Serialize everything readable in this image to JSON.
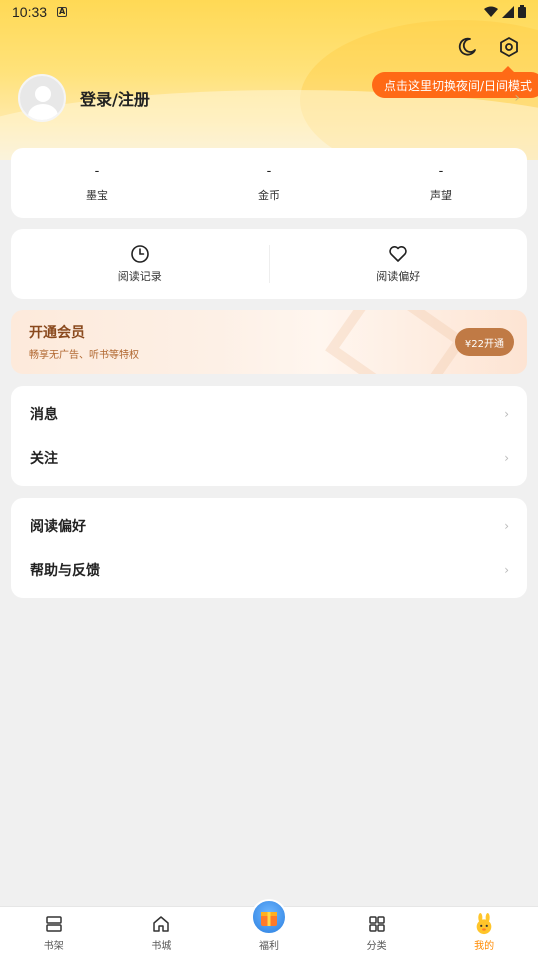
{
  "status_bar": {
    "time": "10:33",
    "a_label": "A"
  },
  "header": {
    "tooltip": "点击这里切换夜间/日间模式",
    "login_label": "登录/注册"
  },
  "stats": [
    {
      "value": "-",
      "label": "墨宝"
    },
    {
      "value": "-",
      "label": "金币"
    },
    {
      "value": "-",
      "label": "声望"
    }
  ],
  "quick": [
    {
      "label": "阅读记录",
      "icon": "clock-icon"
    },
    {
      "label": "阅读偏好",
      "icon": "heart-icon"
    }
  ],
  "vip": {
    "title": "开通会员",
    "subtitle": "畅享无广告、听书等特权",
    "button": "¥22开通"
  },
  "menu1": [
    {
      "label": "消息"
    },
    {
      "label": "关注"
    }
  ],
  "menu2": [
    {
      "label": "阅读偏好"
    },
    {
      "label": "帮助与反馈"
    }
  ],
  "tabbar": [
    {
      "label": "书架",
      "icon": "bookshelf-icon"
    },
    {
      "label": "书城",
      "icon": "home-icon"
    },
    {
      "label": "福利",
      "icon": "gift-icon"
    },
    {
      "label": "分类",
      "icon": "grid-icon"
    },
    {
      "label": "我的",
      "icon": "rabbit-mascot-icon",
      "active": true
    }
  ],
  "colors": {
    "accent": "#ff6a16",
    "active_tab": "#ff8a00",
    "vip_button": "#c07a45",
    "header": "#ffd955"
  }
}
